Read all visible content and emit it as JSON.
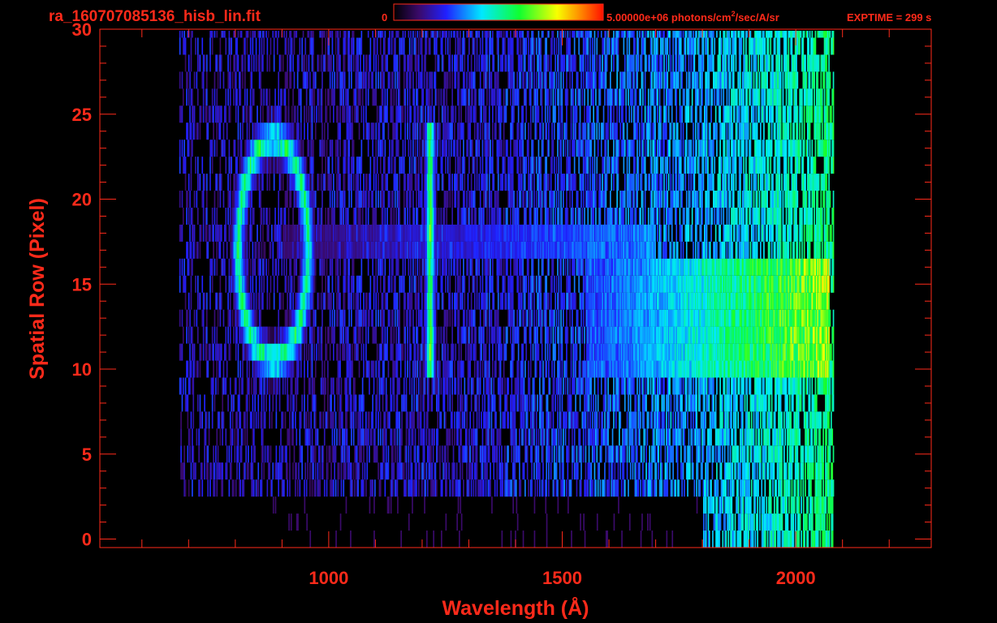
{
  "header": {
    "filename": "ra_160707085136_hisb_lin.fit",
    "colorbar_min": "0",
    "colorbar_max": "5.00000e+06",
    "units_pre": "photons/cm",
    "units_sup": "2",
    "units_post": "/sec/A/sr",
    "exptime": "EXPTIME = 299 s"
  },
  "colors": {
    "axis": "#ff2a1a",
    "background": "#000000"
  },
  "chart_data": {
    "type": "heatmap",
    "title": "ra_160707085136_hisb_lin.fit",
    "xlabel": "Wavelength (Å)",
    "ylabel": "Spatial Row (Pixel)",
    "xlim": [
      510,
      2290
    ],
    "ylim": [
      -0.5,
      30
    ],
    "xticks": [
      1000,
      1500,
      2000
    ],
    "yticks": [
      0,
      5,
      10,
      15,
      20,
      25,
      30
    ],
    "colorscale": "rainbow",
    "colorbar_range": [
      0,
      5000000
    ],
    "data_extent_x": [
      680,
      2080
    ],
    "rows": 31,
    "features": [
      {
        "kind": "ring",
        "center_wavelength": 880,
        "center_row": 17,
        "radius_wavelength": 75,
        "radius_row": 6.5,
        "level": 0.55
      },
      {
        "kind": "vertical_line",
        "wavelength": 1216,
        "row_range": [
          9.5,
          24
        ],
        "level": 0.6
      },
      {
        "kind": "band",
        "row_range": [
          9.5,
          16
        ],
        "wavelength_range": [
          1550,
          2070
        ],
        "level": 0.75
      },
      {
        "kind": "band",
        "row_range": [
          17,
          18.5
        ],
        "wavelength_range": [
          900,
          1700
        ],
        "level": 0.35
      }
    ]
  }
}
